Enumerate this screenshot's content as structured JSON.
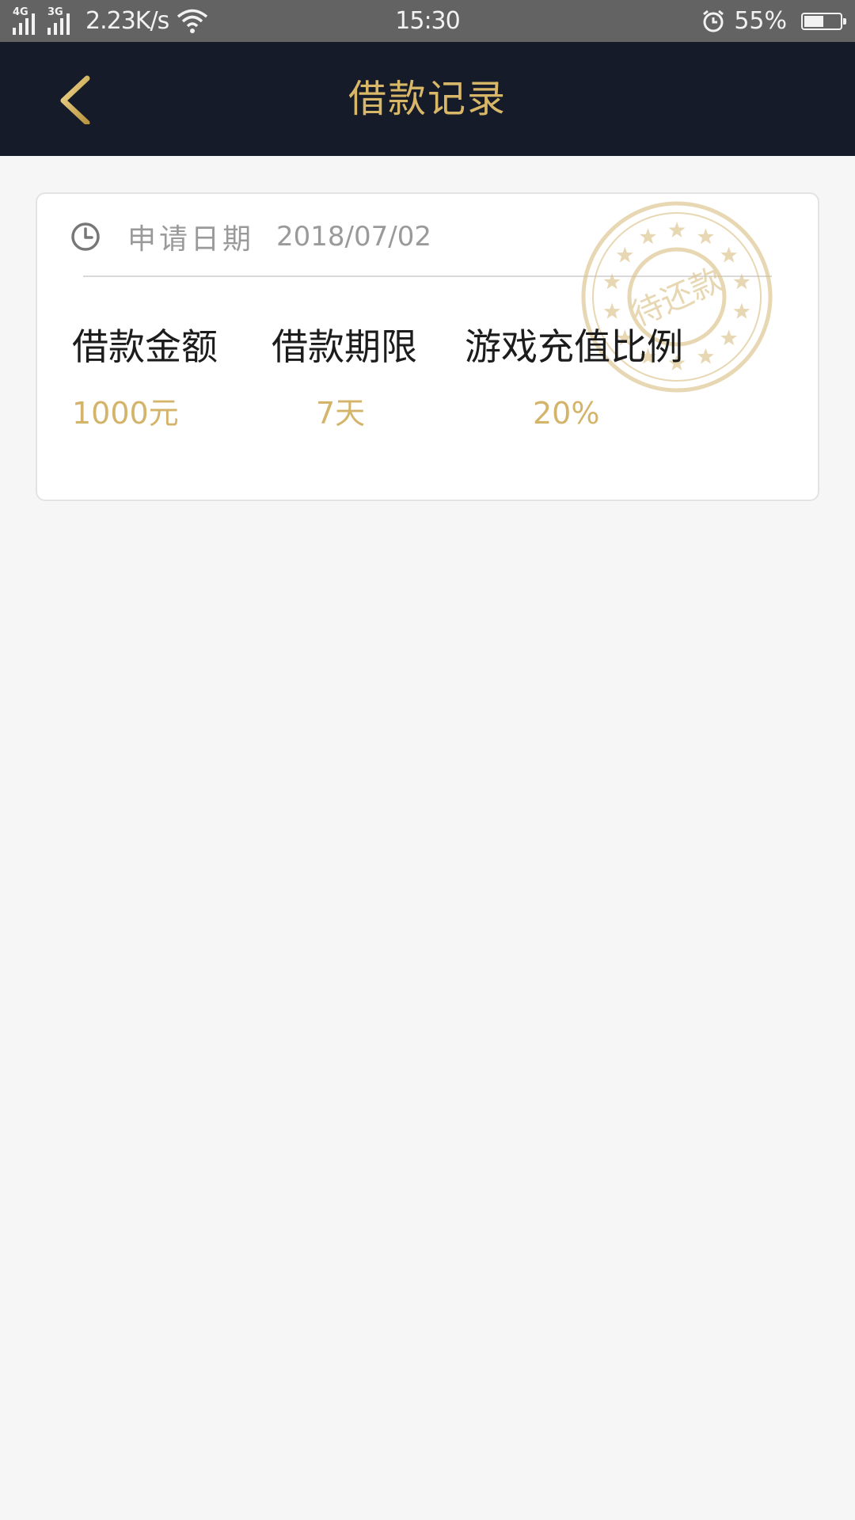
{
  "status_bar": {
    "network_1": "4G",
    "network_2": "3G",
    "speed": "2.23K/s",
    "time": "15:30",
    "battery_percent": "55%",
    "battery_level": 0.55
  },
  "header": {
    "title": "借款记录"
  },
  "record": {
    "date_label": "申请日期",
    "date_value": "2018/07/02",
    "stamp_text": "待还款",
    "amount_label": "借款金额",
    "amount_value": "1000元",
    "term_label": "借款期限",
    "term_value": "7天",
    "ratio_label": "游戏充值比例",
    "ratio_value": "20%"
  },
  "colors": {
    "header_bg": "#151b29",
    "accent_gold": "#d8b768",
    "stamp_gold": "#d9bf84",
    "page_bg": "#f6f6f6"
  },
  "icons": {
    "back": "chevron-left-icon",
    "clock": "clock-icon",
    "wifi": "wifi-icon",
    "alarm": "alarm-icon",
    "battery": "battery-icon"
  }
}
